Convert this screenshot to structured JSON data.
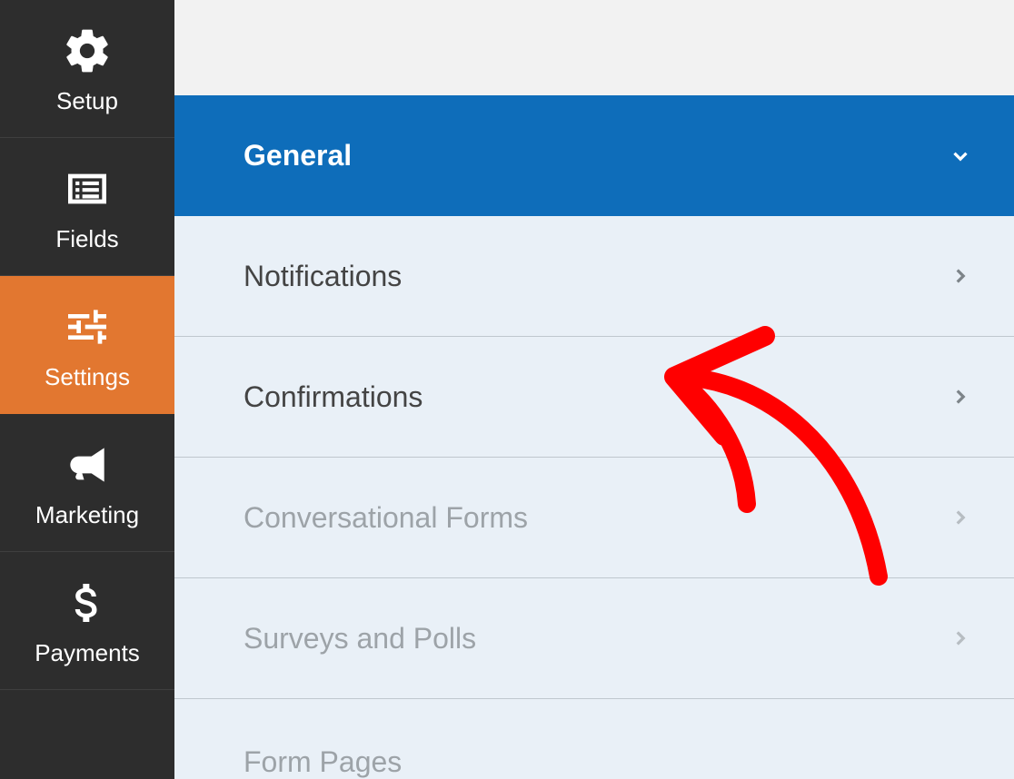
{
  "sidebar": {
    "items": [
      {
        "label": "Setup",
        "icon": "gear-icon",
        "active": false
      },
      {
        "label": "Fields",
        "icon": "list-icon",
        "active": false
      },
      {
        "label": "Settings",
        "icon": "sliders-icon",
        "active": true
      },
      {
        "label": "Marketing",
        "icon": "bullhorn-icon",
        "active": false
      },
      {
        "label": "Payments",
        "icon": "dollar-icon",
        "active": false
      }
    ]
  },
  "settings": {
    "items": [
      {
        "label": "General",
        "active": true,
        "muted": false
      },
      {
        "label": "Notifications",
        "active": false,
        "muted": false
      },
      {
        "label": "Confirmations",
        "active": false,
        "muted": false
      },
      {
        "label": "Conversational Forms",
        "active": false,
        "muted": true
      },
      {
        "label": "Surveys and Polls",
        "active": false,
        "muted": true
      },
      {
        "label": "Form Pages",
        "active": false,
        "muted": true
      }
    ]
  },
  "annotation": {
    "arrow_target": "Confirmations",
    "color": "#ff0000"
  }
}
